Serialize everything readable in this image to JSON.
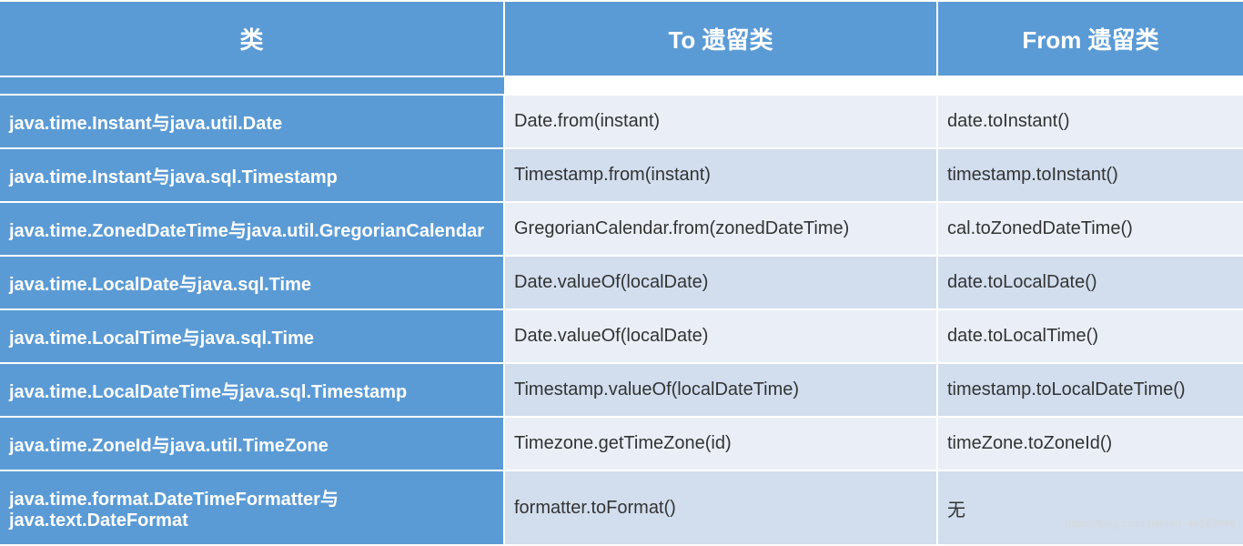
{
  "headers": {
    "class": "类",
    "to": "To 遗留类",
    "from": "From 遗留类"
  },
  "rows": [
    {
      "class": "java.time.Instant与java.util.Date",
      "to": "Date.from(instant)",
      "from": "date.toInstant()"
    },
    {
      "class": "java.time.Instant与java.sql.Timestamp",
      "to": "Timestamp.from(instant)",
      "from": "timestamp.toInstant()"
    },
    {
      "class": "java.time.ZonedDateTime与java.util.GregorianCalendar",
      "to": "GregorianCalendar.from(zonedDateTime)",
      "from": "cal.toZonedDateTime()"
    },
    {
      "class": "java.time.LocalDate与java.sql.Time",
      "to": "Date.valueOf(localDate)",
      "from": "date.toLocalDate()"
    },
    {
      "class": "java.time.LocalTime与java.sql.Time",
      "to": "Date.valueOf(localDate)",
      "from": "date.toLocalTime()"
    },
    {
      "class": "java.time.LocalDateTime与java.sql.Timestamp",
      "to": "Timestamp.valueOf(localDateTime)",
      "from": "timestamp.toLocalDateTime()"
    },
    {
      "class": "java.time.ZoneId与java.util.TimeZone",
      "to": "Timezone.getTimeZone(id)",
      "from": "timeZone.toZoneId()"
    },
    {
      "class": "java.time.format.DateTimeFormatter与java.text.DateFormat",
      "to": "formatter.toFormat()",
      "from": "无"
    }
  ],
  "watermark": "https://blog.csdn.net/m0_46163949"
}
